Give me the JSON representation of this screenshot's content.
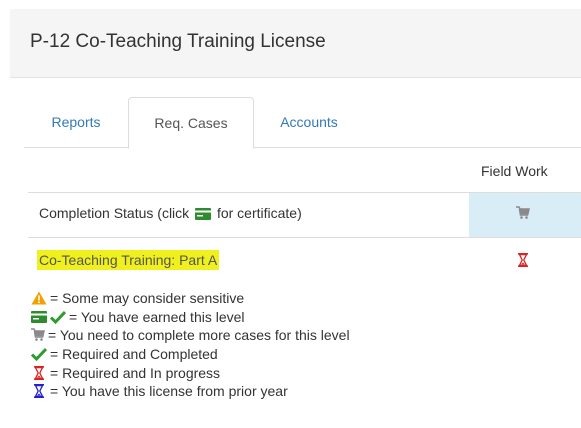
{
  "header": {
    "title": "P-12 Co-Teaching Training License"
  },
  "tabs": [
    {
      "label": "Reports",
      "active": false
    },
    {
      "label": "Req. Cases",
      "active": true
    },
    {
      "label": "Accounts",
      "active": false
    }
  ],
  "table": {
    "column_header": "Field Work",
    "completion_row": {
      "label_prefix": "Completion Status (click",
      "label_suffix": "for certificate)",
      "field_work_icon": "cart-icon"
    },
    "course_row": {
      "label": "Co-Teaching Training: Part A",
      "field_work_icon": "hourglass-red-icon"
    }
  },
  "legend": {
    "items": [
      {
        "icons": [
          "warning-icon"
        ],
        "text": "= Some may consider sensitive"
      },
      {
        "icons": [
          "certificate-icon",
          "check-icon"
        ],
        "text": "= You have earned this level"
      },
      {
        "icons": [
          "cart-icon"
        ],
        "text": "= You need to complete more cases for this level"
      },
      {
        "icons": [
          "check-icon"
        ],
        "text": "= Required and Completed"
      },
      {
        "icons": [
          "hourglass-red-icon"
        ],
        "text": "= Required and In progress"
      },
      {
        "icons": [
          "hourglass-blue-icon"
        ],
        "text": "= You have this license from prior year"
      }
    ]
  },
  "colors": {
    "link": "#337ab7",
    "highlight": "#f0f01e",
    "status_cell": "#d9edf7",
    "certificate_green": "#2e8b2e",
    "check_green": "#2f9b2f",
    "warning_orange": "#f0a000",
    "hourglass_red": "#dd2222",
    "hourglass_blue": "#2222cc",
    "cart_gray": "#8a8a8a"
  }
}
